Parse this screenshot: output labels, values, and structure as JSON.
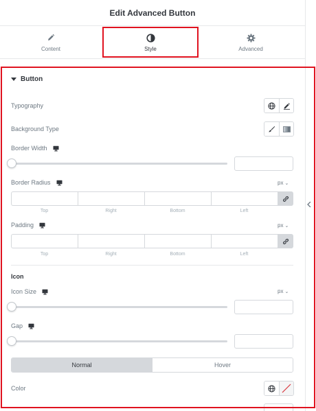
{
  "header": {
    "title": "Edit Advanced Button"
  },
  "tabs": [
    {
      "label": "Content",
      "icon": "pencil-icon"
    },
    {
      "label": "Style",
      "icon": "half-circle-icon",
      "active": true
    },
    {
      "label": "Advanced",
      "icon": "gear-icon"
    }
  ],
  "section": {
    "title": "Button",
    "typography": {
      "label": "Typography",
      "buttons": [
        "globe-icon",
        "pencil-icon"
      ]
    },
    "background_type": {
      "label": "Background Type",
      "buttons": [
        "brush-icon",
        "gradient-icon"
      ]
    },
    "border_width": {
      "label": "Border Width",
      "value": ""
    },
    "border_radius": {
      "label": "Border Radius",
      "unit": "px",
      "sides": [
        "Top",
        "Right",
        "Bottom",
        "Left"
      ]
    },
    "padding": {
      "label": "Padding",
      "unit": "px",
      "sides": [
        "Top",
        "Right",
        "Bottom",
        "Left"
      ]
    },
    "icon_heading": "Icon",
    "icon_size": {
      "label": "Icon Size",
      "unit": "px",
      "value": ""
    },
    "gap": {
      "label": "Gap",
      "value": ""
    },
    "state_tabs": {
      "normal": "Normal",
      "hover": "Hover",
      "active": "Normal"
    },
    "color": {
      "label": "Color"
    }
  },
  "colors": {
    "highlight": "#e0121f",
    "accent_text": "#33373d",
    "muted_text": "#6d7882"
  }
}
